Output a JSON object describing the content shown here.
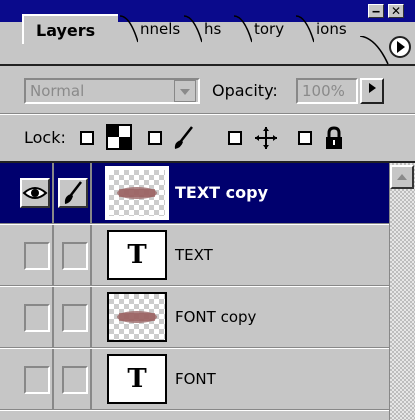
{
  "tabs": [
    {
      "label": "Layers",
      "active": true
    },
    {
      "label": "nnels",
      "active": false
    },
    {
      "label": "hs",
      "active": false
    },
    {
      "label": "tory",
      "active": false
    },
    {
      "label": "ions",
      "active": false
    }
  ],
  "window_buttons": {
    "minimize": "‒",
    "close": "✕"
  },
  "blend": {
    "mode": "Normal",
    "opacity_label": "Opacity:",
    "opacity_value": "100%"
  },
  "lock": {
    "label": "Lock:"
  },
  "layers": [
    {
      "name": "TEXT copy",
      "type": "raster",
      "selected": true
    },
    {
      "name": "TEXT",
      "type": "text",
      "selected": false
    },
    {
      "name": "FONT copy",
      "type": "raster",
      "selected": false
    },
    {
      "name": "FONT",
      "type": "text",
      "selected": false
    }
  ],
  "text_thumb_glyph": "T",
  "colors": {
    "titlebar": "#0a0a8c",
    "selected_layer": "#00006e",
    "panel": "#c6c6c6"
  }
}
